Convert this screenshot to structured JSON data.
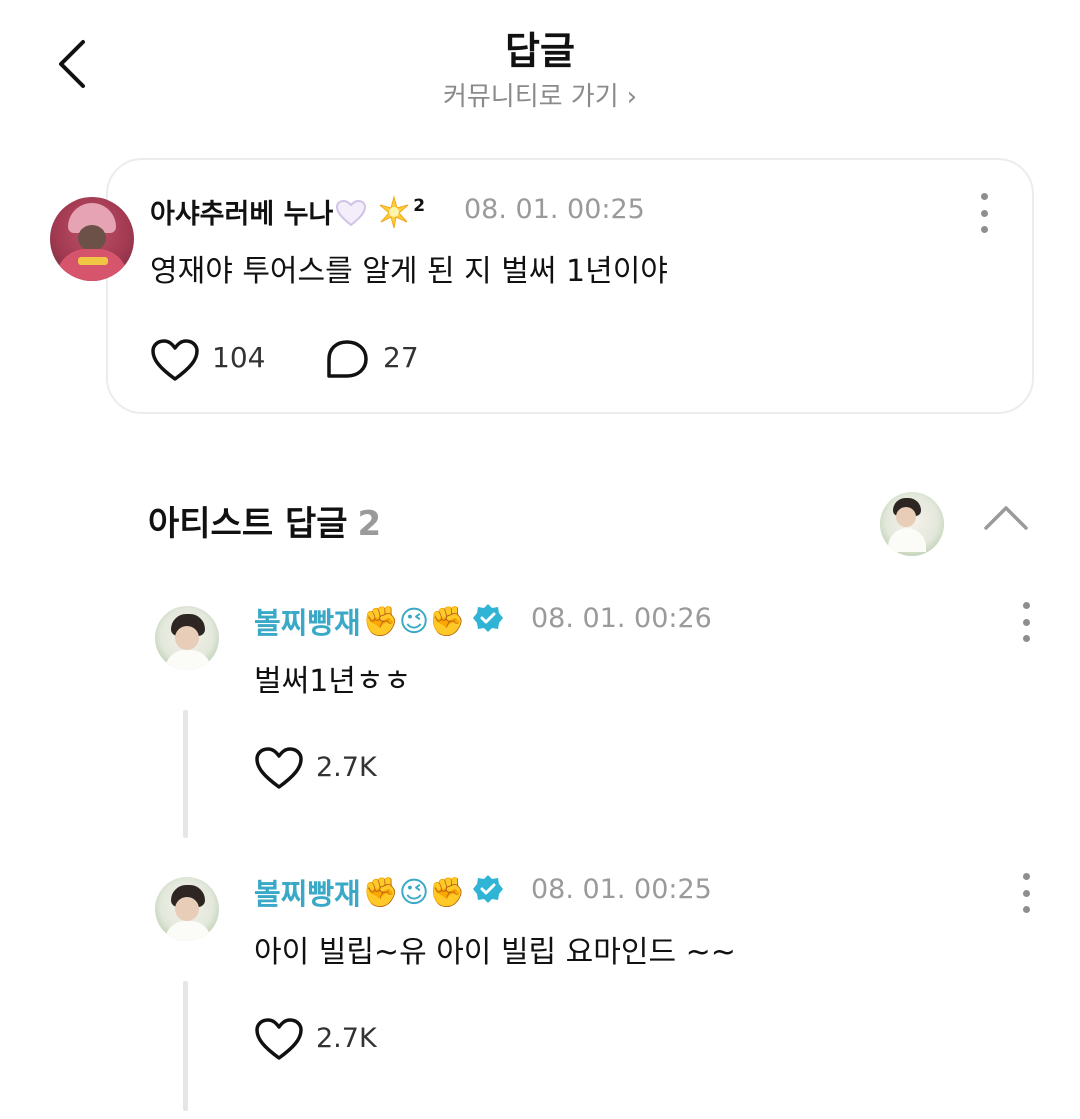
{
  "header": {
    "title": "답글",
    "community_link": "커뮤니티로 가기",
    "community_chevron": "›"
  },
  "post": {
    "author": "아샤추러베 누나",
    "author_suffix": "2",
    "time": "08. 01. 00:25",
    "body": "영재야 투어스를 알게 된 지 벌써 1년이야",
    "likes": "104",
    "comments": "27"
  },
  "artist_replies": {
    "title": "아티스트 답글",
    "count": "2",
    "items": [
      {
        "name": "볼찌빵재",
        "emojis": "✊😉✊",
        "time": "08. 01. 00:26",
        "body": "벌써1년ㅎㅎ",
        "likes": "2.7K"
      },
      {
        "name": "볼찌빵재",
        "emojis": "✊😉✊",
        "time": "08. 01. 00:25",
        "body": "아이 빌립~유 아이 빌립 요마인드 ~~",
        "likes": "2.7K"
      }
    ]
  },
  "colors": {
    "accent_name": "#3aa9c7",
    "meta_gray": "#9a9a9a",
    "card_border": "#ececec"
  },
  "icons": [
    "chevron-left-icon",
    "heart-outline-icon",
    "comment-bubble-icon",
    "more-vertical-icon",
    "verified-badge-icon",
    "chevron-up-icon",
    "white-heart-emoji",
    "sparkle-star-emoji"
  ]
}
